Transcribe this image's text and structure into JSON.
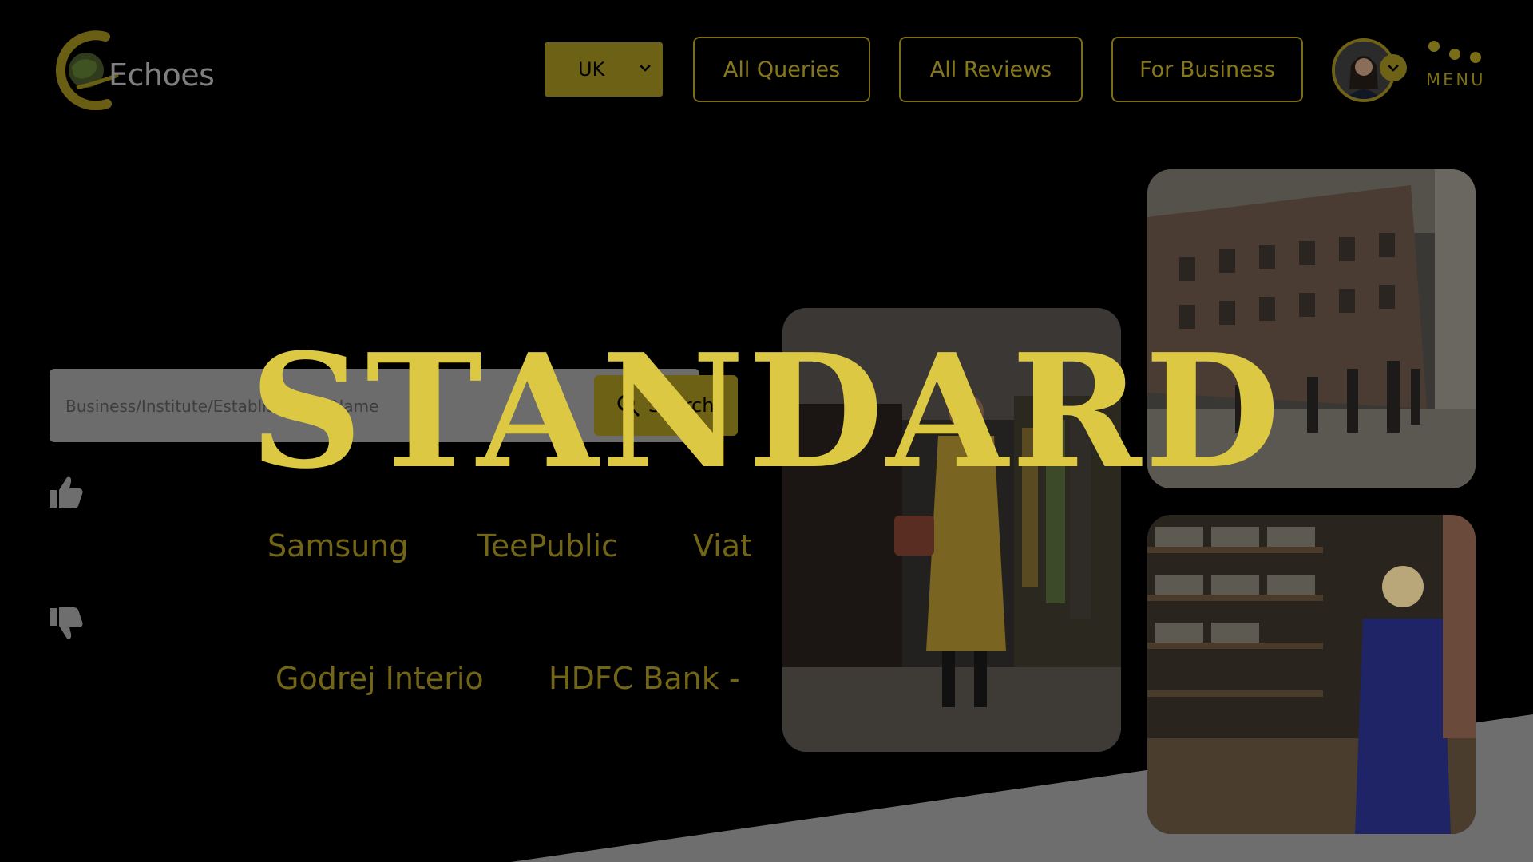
{
  "header": {
    "logo_text": "Echoes",
    "country_select": {
      "selected": "UK"
    },
    "nav": [
      "All Queries",
      "All Reviews",
      "For Business"
    ],
    "menu_label": "MENU"
  },
  "search": {
    "placeholder": "Business/Institute/Establishment Name",
    "button_label": "Search"
  },
  "brands": {
    "positive": [
      "Samsung",
      "TeePublic",
      "Viat"
    ],
    "negative": [
      "Godrej Interio",
      "HDFC Bank -"
    ]
  },
  "overlay": {
    "watermark": "STANDARD"
  },
  "colors": {
    "background": "#000000",
    "accent_dim": "#6c6114",
    "watermark": "#dcc843",
    "wedge": "#6e6e6e"
  },
  "icons": [
    "logo-globe-icon",
    "chevron-down-icon",
    "search-icon",
    "thumbs-up-icon",
    "thumbs-down-icon",
    "menu-dots-icon"
  ]
}
